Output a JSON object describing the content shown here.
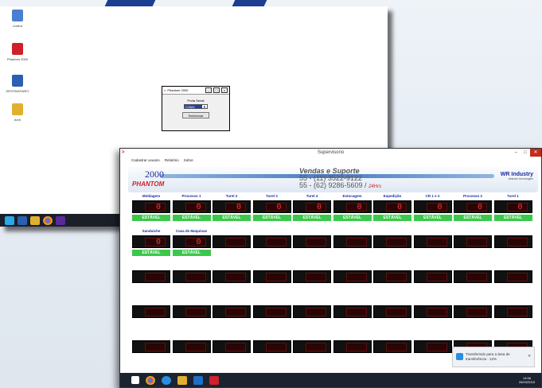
{
  "desktop": {
    "icons": [
      {
        "label": "Lixeira",
        "icon": "recycle-bin-icon",
        "color": "#4a7fd0"
      },
      {
        "label": "Phantom 2000",
        "icon": "phantom-logo-icon",
        "color": "#d0202a"
      },
      {
        "label": "DESTINATARIO",
        "icon": "word-doc-icon",
        "color": "#2b5fb3"
      },
      {
        "label": "Arch",
        "icon": "folder-icon",
        "color": "#e0b030"
      }
    ]
  },
  "dialog": {
    "title": "Phantom 2000",
    "port_label": "Porta Serial",
    "port_value": "COM4",
    "select_button": "Selecionar"
  },
  "supervisor": {
    "title": "Supervisorio",
    "menu": [
      "Cadastrar usuario",
      "Relatório",
      "Sobre"
    ],
    "banner": {
      "logo_top": "2000",
      "logo_bottom": "PHANTOM",
      "line1": "Vendas e Suporte",
      "line2": "55 - (11) 3522-9122",
      "line3": "55 - (62) 9286-5609 /",
      "line3_accent": "24Hrs",
      "brand": "WR Industry",
      "brand_sub": "detector tecnologies"
    },
    "status_label": "ESTÁVEL",
    "stations": [
      {
        "name": "Moldagem",
        "value": "0",
        "status": true
      },
      {
        "name": "Processo 1",
        "value": "0",
        "status": true
      },
      {
        "name": "Turel 2",
        "value": "0",
        "status": true
      },
      {
        "name": "Turel 3",
        "value": "0",
        "status": true
      },
      {
        "name": "Turel 4",
        "value": "0",
        "status": true
      },
      {
        "name": "Estocagem",
        "value": "0",
        "status": true
      },
      {
        "name": "Expedição",
        "value": "0",
        "status": true
      },
      {
        "name": "CR 1 e 2",
        "value": "0",
        "status": true
      },
      {
        "name": "Processo 2",
        "value": "0",
        "status": true
      },
      {
        "name": "Turel 1",
        "value": "0",
        "status": true
      },
      {
        "name": "Sanduiche",
        "value": "0",
        "status": true
      },
      {
        "name": "Casa de Maquinas",
        "value": "0",
        "status": true
      }
    ],
    "toast": "Transferindo para a área de transferência - 12%",
    "clock": {
      "time": "14:56",
      "date": "26/03/2015"
    }
  }
}
